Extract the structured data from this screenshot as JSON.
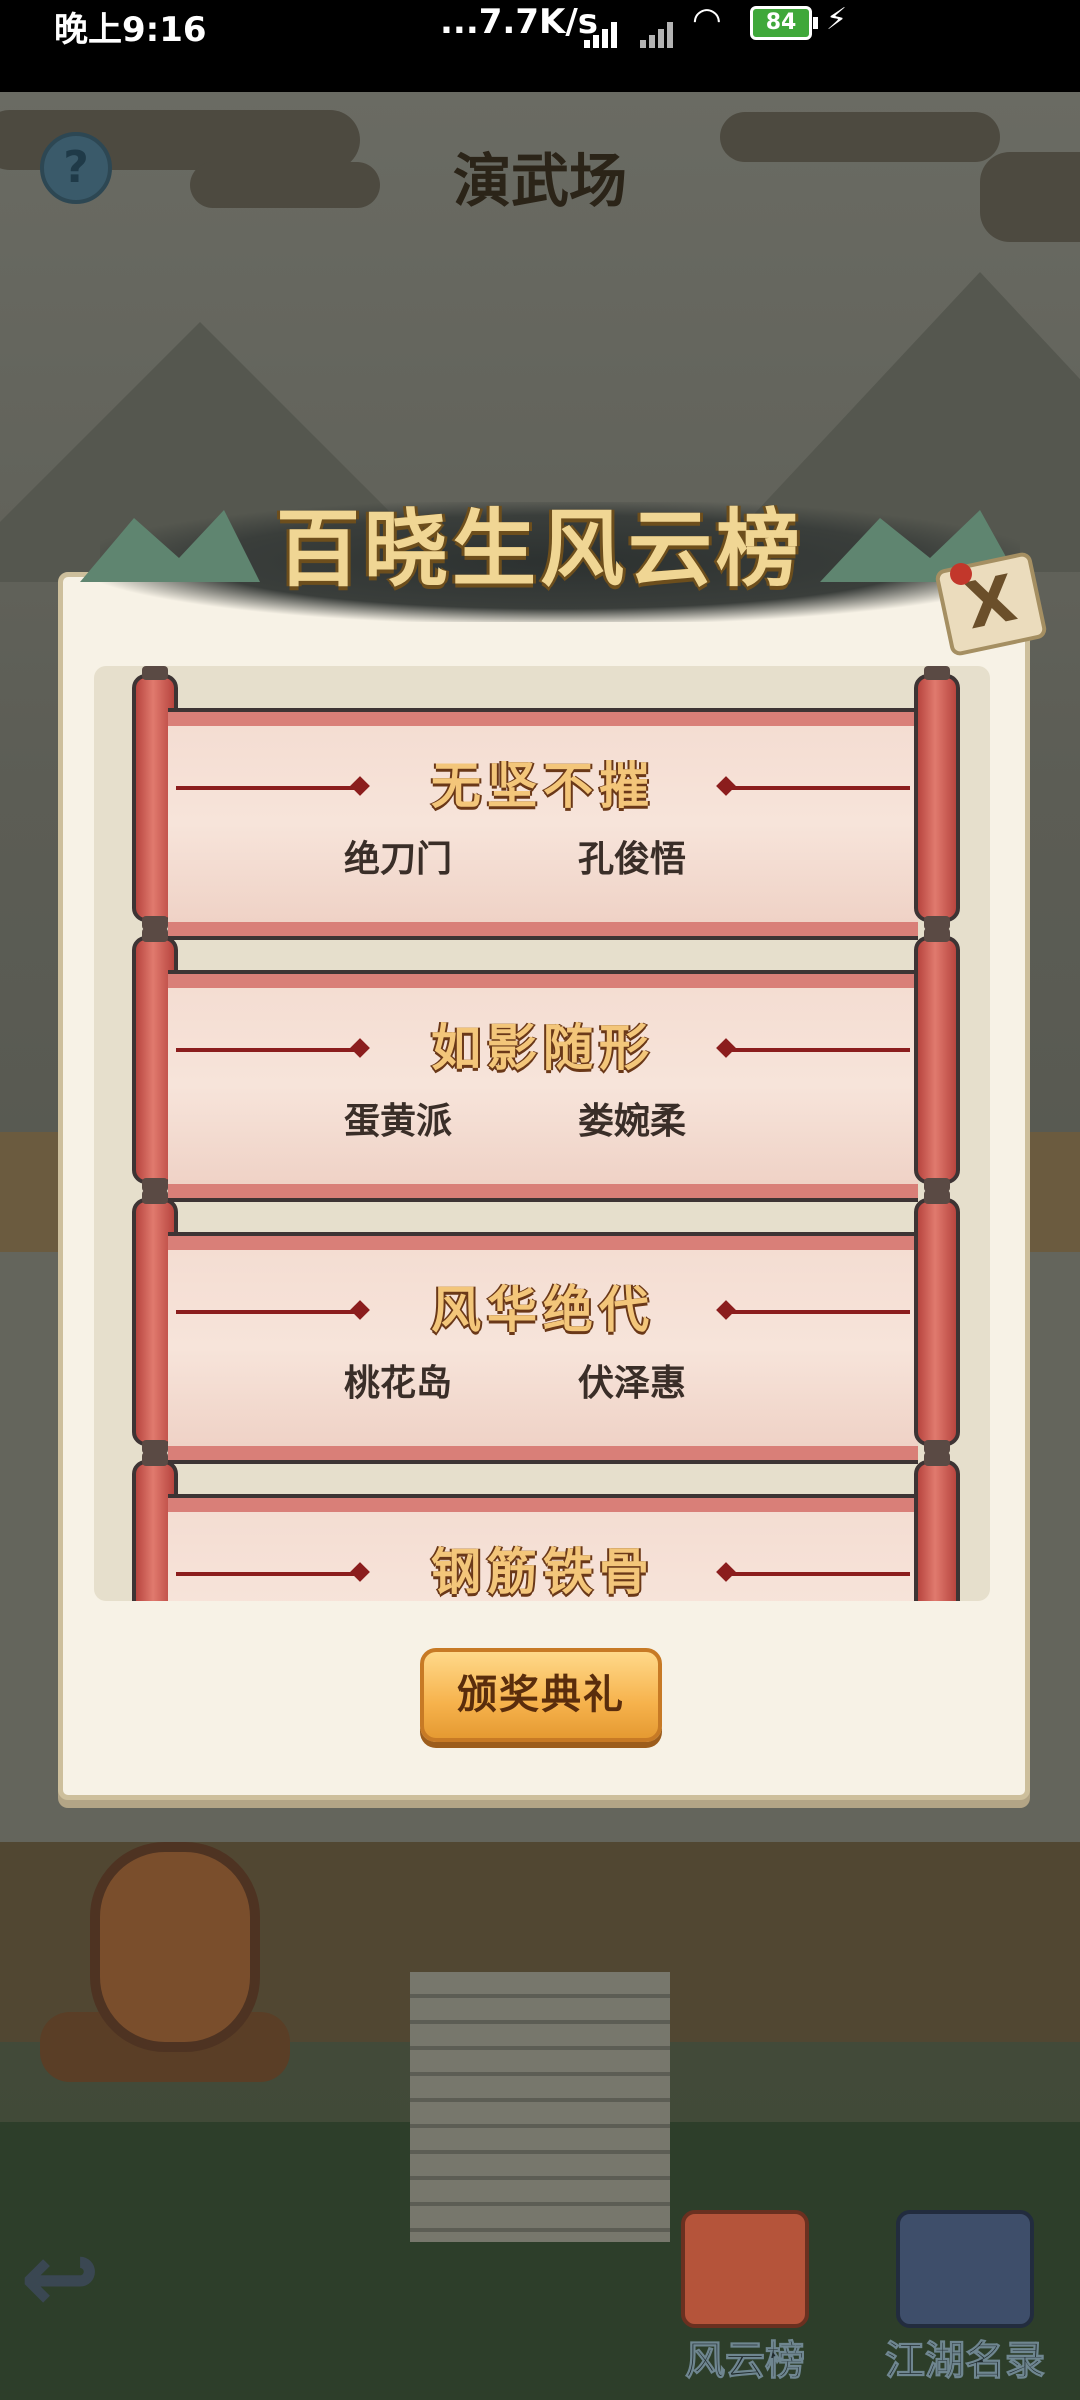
{
  "status_bar": {
    "time": "晚上9:16",
    "network_speed": "...7.7K/s",
    "battery": "84"
  },
  "scene": {
    "title": "演武场",
    "help_label": "?"
  },
  "modal": {
    "title": "百晓生风云榜",
    "close_label": "X",
    "entries": [
      {
        "honor": "无坚不摧",
        "faction": "绝刀门",
        "person": "孔俊悟"
      },
      {
        "honor": "如影随形",
        "faction": "蛋黄派",
        "person": "娄婉柔"
      },
      {
        "honor": "风华绝代",
        "faction": "桃花岛",
        "person": "伏泽惠"
      },
      {
        "honor": "钢筋铁骨",
        "faction": "",
        "person": ""
      }
    ],
    "award_button": "颁奖典礼"
  },
  "bottom_nav": {
    "ranking_label": "风云榜",
    "registry_label": "江湖名录"
  },
  "colors": {
    "modal_bg": "#f7f2e6",
    "scroll_red": "#d97f78",
    "button_orange": "#f6b24c",
    "title_gold": "#f0d694"
  }
}
